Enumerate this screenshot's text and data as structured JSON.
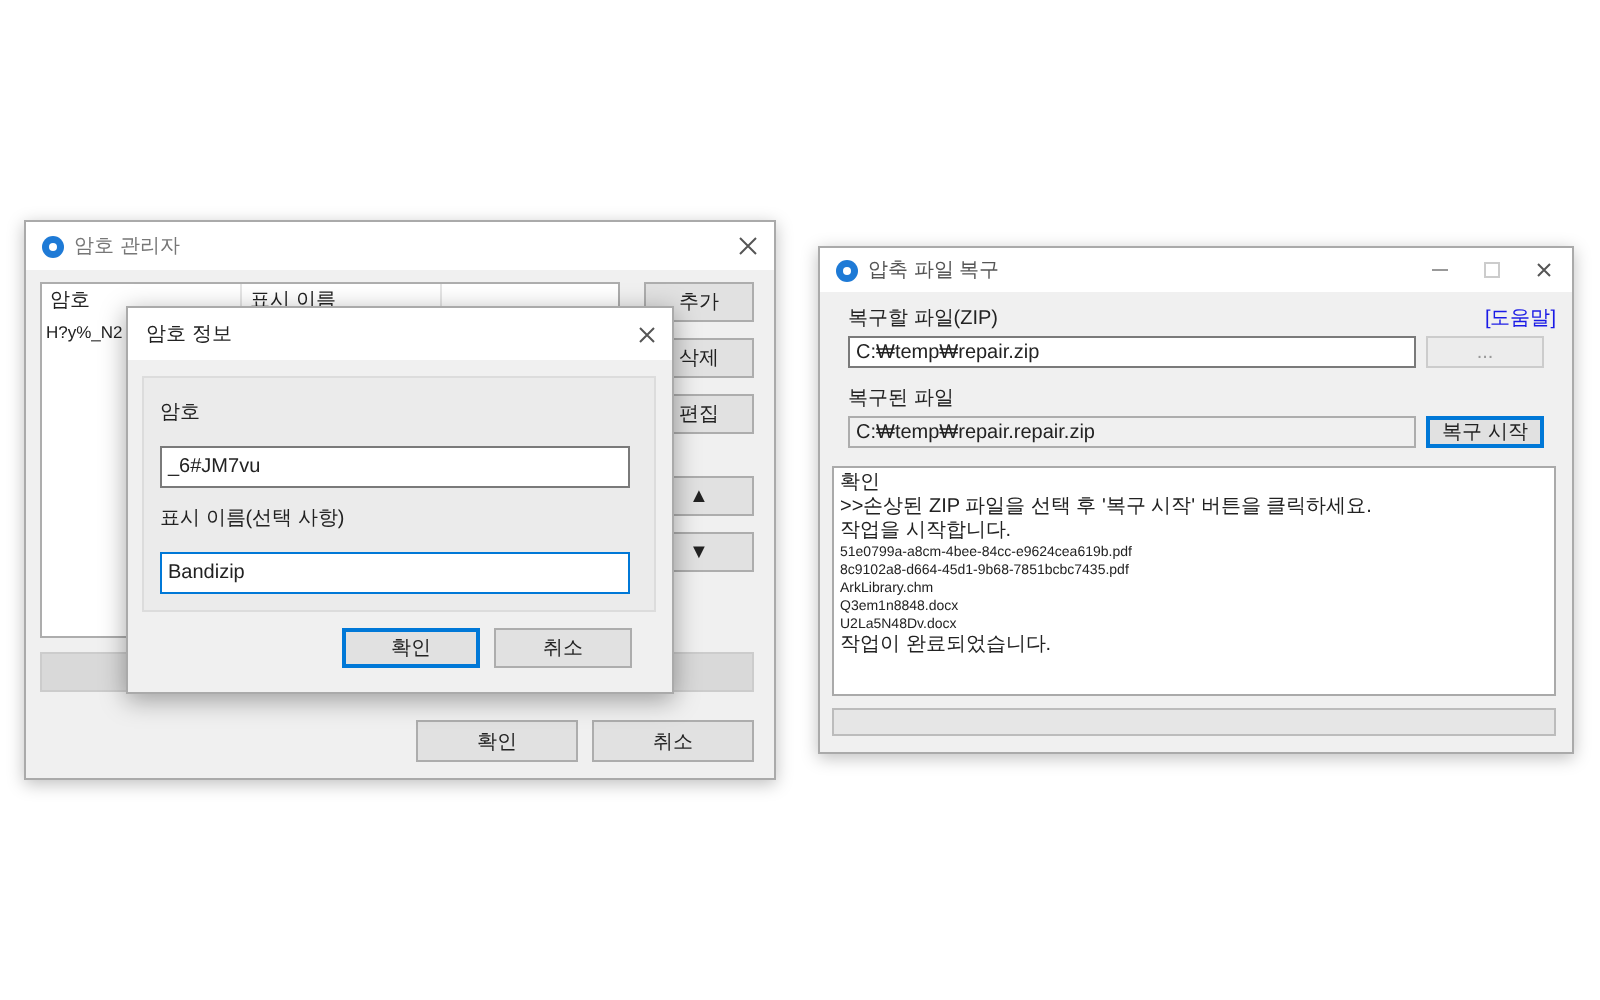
{
  "password_manager": {
    "title": "암호 관리자",
    "columns": [
      "암호",
      "표시 이름"
    ],
    "rows": [
      [
        "H?y%_N2"
      ]
    ],
    "side_buttons": [
      "추가",
      "삭제",
      "편집",
      "▲",
      "▼"
    ],
    "footer_buttons": [
      "확인",
      "취소"
    ]
  },
  "password_dialog": {
    "title": "암호 정보",
    "fields": [
      {
        "label": "암호",
        "value": "_6#JM7vu",
        "focused": false
      },
      {
        "label": "표시 이름(선택 사항)",
        "value": "Bandizip",
        "focused": true
      }
    ],
    "buttons": [
      {
        "label": "확인",
        "default": true
      },
      {
        "label": "취소",
        "default": false
      }
    ]
  },
  "repair_window": {
    "title": "압축 파일 복구",
    "help_link": "[도움말]",
    "source": {
      "label": "복구할 파일(ZIP)",
      "value": "C:₩temp₩repair.zip",
      "readonly": false
    },
    "browse_button": {
      "label": "...",
      "disabled": true
    },
    "output": {
      "label": "복구된 파일",
      "value": "C:₩temp₩repair.repair.zip",
      "readonly": true
    },
    "start_button": {
      "label": "복구 시작",
      "default": true
    },
    "log": [
      "확인",
      ">>손상된 ZIP 파일을 선택 후 '복구 시작' 버튼을 클릭하세요.",
      "작업을 시작합니다.",
      "51e0799a-a8cm-4bee-84cc-e9624cea619b.pdf",
      "8c9102a8-d664-45d1-9b68-7851bcbc7435.pdf",
      "ArkLibrary.chm",
      "Q3em1n8848.docx",
      "U2La5N48Dv.docx",
      "작업이 완료되었습니다."
    ],
    "progress": {
      "level": 0
    }
  }
}
